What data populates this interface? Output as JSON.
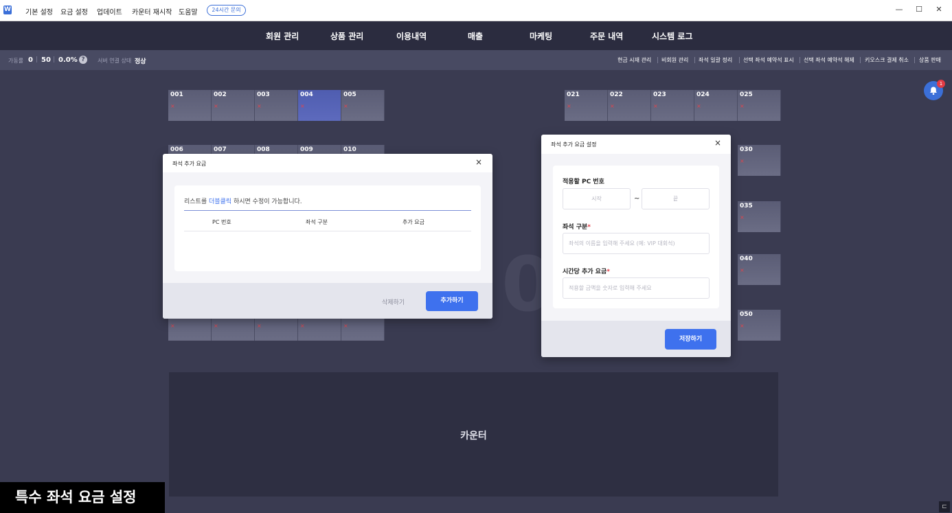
{
  "titlebar": {
    "logo": "W",
    "menu": [
      "기본 설정",
      "요금 설정",
      "업데이트",
      "카운터 재시작",
      "도움말"
    ],
    "support_pill": "24시간 문의",
    "controls": {
      "minimize": "—",
      "maximize": "☐",
      "close": "✕"
    }
  },
  "nav": [
    "회원 관리",
    "상품 관리",
    "이용내역",
    "매출",
    "마케팅",
    "주문 내역",
    "시스템 로그"
  ],
  "status": {
    "usage_label": "가동률",
    "used": "0",
    "total": "50",
    "rate": "0.0%",
    "help": "?",
    "server_label": "서버 연결 상태",
    "server_value": "정상",
    "sep": "|"
  },
  "quick_actions": [
    "현금 시재 관리",
    "비회원 관리",
    "좌석 일괄 정리",
    "선택 좌석 예약석 표시",
    "선택 좌석 예약석 해제",
    "키오스크 결제 취소",
    "상품 판매"
  ],
  "seats": {
    "row1_left": [
      "001",
      "002",
      "003",
      "004",
      "005"
    ],
    "row2_left": [
      "006",
      "007",
      "008",
      "009",
      "010"
    ],
    "row1_right": [
      "021",
      "022",
      "023",
      "024",
      "025"
    ],
    "right_col": [
      "030",
      "035",
      "040",
      "050"
    ],
    "off_mark": "×"
  },
  "watermark": "0 8",
  "counter_label": "카운터",
  "notification_count": "1",
  "caption": "특수 좌석 요금 설정",
  "corner_icon": "⊏",
  "dialog_list": {
    "title": "좌석 추가 요금",
    "close": "×",
    "info_before": "리스트를 ",
    "info_highlight": "더블클릭",
    "info_after": " 하시면 수정이 가능합니다.",
    "columns": [
      "PC 번호",
      "좌석 구분",
      "추가 요금"
    ],
    "delete_label": "삭제하기",
    "add_label": "추가하기"
  },
  "dialog_setting": {
    "title": "좌석 추가 요금 설정",
    "close": "×",
    "pc_label": "적용할 PC 번호",
    "start_placeholder": "시작",
    "tilde": "~",
    "end_placeholder": "끝",
    "seat_type_label": "좌석 구분",
    "required_mark": "*",
    "seat_type_placeholder": "좌석의 이름을 입력해 주세요 (예: VIP 대회석)",
    "hourly_label": "시간당 추가 요금",
    "hourly_placeholder": "적용할 금액을 숫자로 입력해 주세요",
    "save_label": "저장하기"
  }
}
